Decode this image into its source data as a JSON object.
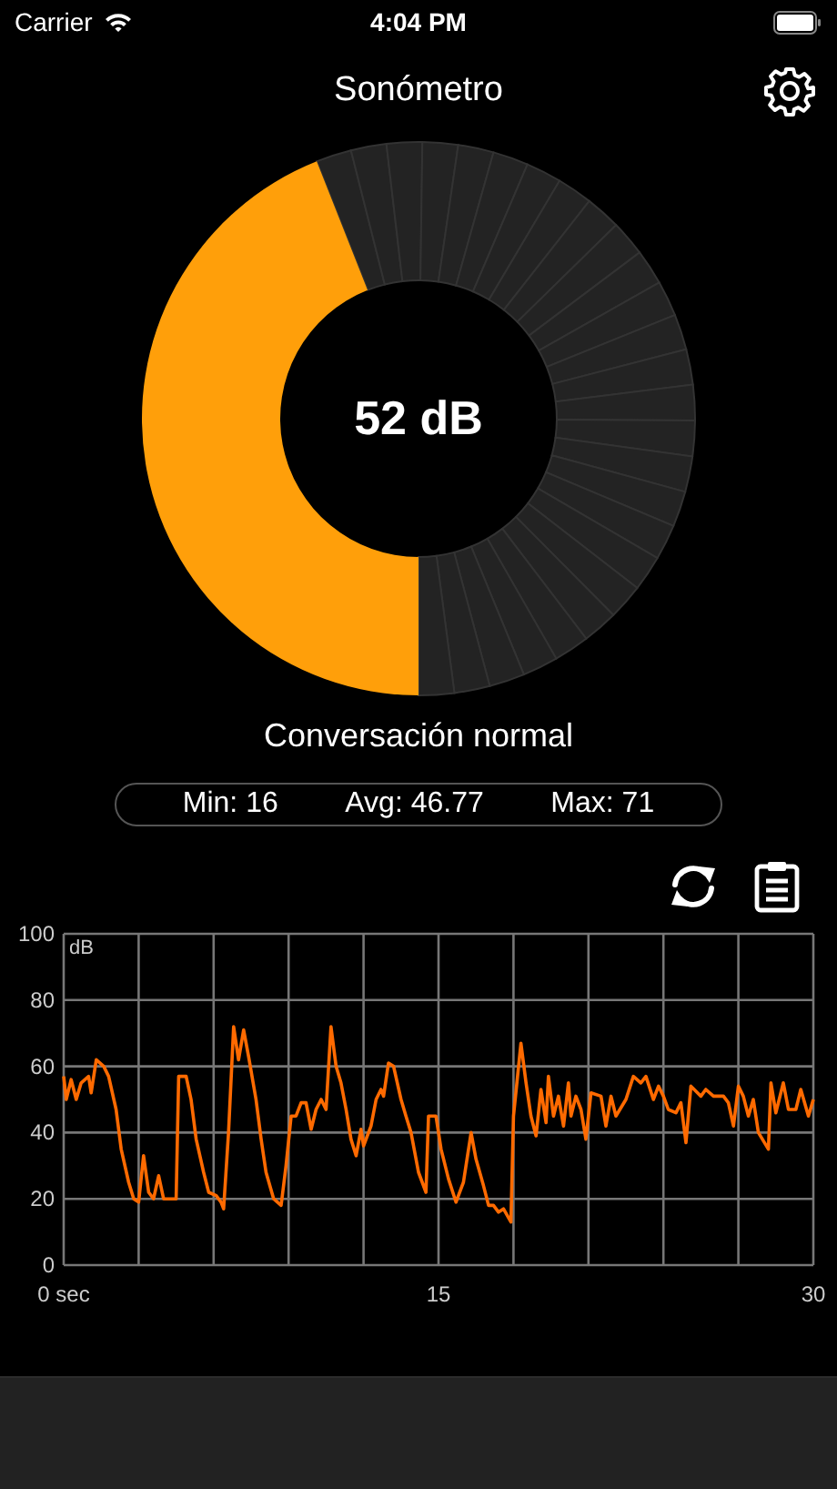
{
  "status_bar": {
    "carrier": "Carrier",
    "time": "4:04 PM"
  },
  "nav": {
    "title": "Sonómetro"
  },
  "gauge": {
    "reading": "52 dB",
    "level": 0.44,
    "caption": "Conversación normal"
  },
  "stats": [
    "Min: 16",
    "Avg: 46.77",
    "Max: 71"
  ],
  "chart": {
    "chart_data": {
      "type": "line",
      "grid": true,
      "xlim": [
        0,
        30
      ],
      "ylim": [
        0,
        100
      ],
      "xticks": [
        {
          "value": 0,
          "label": "0 sec"
        },
        {
          "value": 15,
          "label": "15"
        },
        {
          "value": 30,
          "label": "30"
        }
      ],
      "yticks": [
        0,
        20,
        40,
        60,
        80,
        100
      ],
      "x": [
        0,
        0.1,
        0.3,
        0.5,
        0.7,
        1.0,
        1.1,
        1.3,
        1.6,
        1.8,
        2.1,
        2.3,
        2.6,
        2.8,
        3.0,
        3.2,
        3.4,
        3.6,
        3.8,
        4.0,
        4.3,
        4.5,
        4.6,
        4.9,
        5.1,
        5.3,
        5.6,
        5.8,
        6.1,
        6.3,
        6.4,
        6.6,
        6.8,
        7.0,
        7.2,
        7.4,
        7.7,
        7.9,
        8.1,
        8.4,
        8.7,
        8.9,
        9.1,
        9.3,
        9.5,
        9.7,
        9.9,
        10.1,
        10.3,
        10.5,
        10.7,
        10.9,
        11.1,
        11.3,
        11.5,
        11.7,
        11.9,
        12.0,
        12.3,
        12.5,
        12.7,
        12.8,
        13.0,
        13.2,
        13.5,
        13.7,
        13.9,
        14.2,
        14.5,
        14.6,
        14.9,
        15.1,
        15.4,
        15.7,
        16.0,
        16.3,
        16.5,
        16.8,
        17.0,
        17.2,
        17.4,
        17.6,
        17.9,
        18.0,
        18.3,
        18.5,
        18.7,
        18.9,
        19.1,
        19.3,
        19.4,
        19.6,
        19.8,
        20.0,
        20.2,
        20.3,
        20.5,
        20.7,
        20.9,
        21.1,
        21.5,
        21.7,
        21.9,
        22.1,
        22.5,
        22.8,
        23.1,
        23.3,
        23.6,
        23.8,
        24.0,
        24.2,
        24.5,
        24.7,
        24.9,
        25.1,
        25.5,
        25.7,
        26.0,
        26.4,
        26.6,
        26.8,
        27.0,
        27.2,
        27.4,
        27.6,
        27.8,
        28.2,
        28.3,
        28.5,
        28.8,
        29.0,
        29.3,
        29.5,
        29.8,
        30.0
      ],
      "series": [
        {
          "name": "dB",
          "color": "#ff6a00",
          "values": [
            57,
            50,
            56,
            50,
            55,
            57,
            52,
            62,
            60,
            57,
            47,
            35,
            25,
            20,
            19,
            33,
            22,
            20,
            27,
            20,
            20,
            20,
            57,
            57,
            50,
            38,
            28,
            22,
            21,
            19,
            17,
            40,
            72,
            62,
            71,
            63,
            50,
            38,
            28,
            20,
            18,
            30,
            45,
            45,
            49,
            49,
            41,
            47,
            50,
            47,
            72,
            60,
            55,
            47,
            38,
            33,
            41,
            36,
            42,
            50,
            53,
            51,
            61,
            60,
            50,
            45,
            40,
            28,
            22,
            45,
            45,
            35,
            26,
            19,
            25,
            40,
            32,
            24,
            18,
            18,
            16,
            17,
            13,
            45,
            67,
            55,
            45,
            39,
            53,
            43,
            57,
            45,
            51,
            42,
            55,
            45,
            51,
            47,
            38,
            52,
            51,
            42,
            51,
            45,
            50,
            57,
            55,
            57,
            50,
            54,
            51,
            47,
            46,
            49,
            37,
            54,
            51,
            53,
            51,
            51,
            49,
            42,
            54,
            51,
            45,
            50,
            40,
            35,
            55,
            46,
            55,
            47,
            47,
            53,
            45,
            50
          ]
        }
      ]
    }
  }
}
